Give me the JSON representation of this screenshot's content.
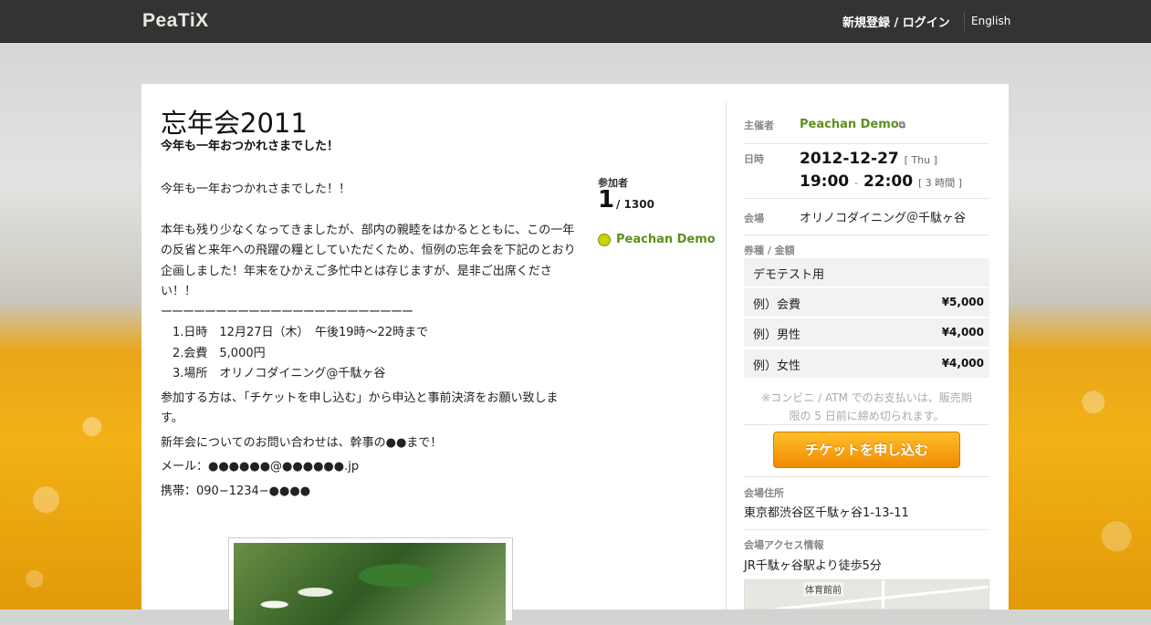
{
  "header": {
    "logo": "PeaTiX",
    "login": "新規登録 / ログイン",
    "language": "English"
  },
  "event": {
    "title": "忘年会2011",
    "subtitle": "今年も一年おつかれさまでした！",
    "description": [
      "今年も一年おつかれさまでした！！",
      "",
      "本年も残り少なくなってきましたが、部内の親睦をはかるとともに、この一年の反省と来年への飛躍の糧としていただくため、恒例の忘年会を下記のとおり企画しました！年末をひかえご多忙中とは存じますが、是非ご出席ください！！",
      "ーーーーーーーーーーーーーーーーーーーーーーー",
      "　1.日時　12月27日（木）　午後19時～22時まで",
      "　2.会費　5,000円",
      "　3.場所　オリノコダイニング@千駄ヶ谷"
    ],
    "description2": [
      "参加する方は、「チケットを申し込む」から申込と事前決済をお願い致します。",
      "新年会についてのお問い合わせは、幹事の●●まで！",
      "メール：●●●●●●@●●●●●●.jp",
      "携帯：090−1234−●●●●"
    ]
  },
  "attendees": {
    "label": "参加者",
    "count": "1",
    "total": "/ 1300",
    "list": [
      {
        "name": "Peachan Demo",
        "avatar": "avatar-icon"
      }
    ]
  },
  "sidebar": {
    "organizer_label": "主催者",
    "organizer_name": "Peachan Demo",
    "external_icon": "external-link-icon",
    "date_label": "日時",
    "date": "2012-12-27",
    "weekday": "[ Thu ]",
    "time_start": "19:00",
    "time_sep": "-",
    "time_end": "22:00",
    "duration": "[ 3 時間 ]",
    "venue_label": "会場",
    "venue": "オリノコダイニング＠千駄ヶ谷",
    "tickets_label": "券種 / 金額",
    "tickets": [
      {
        "name": "デモテスト用",
        "price": ""
      },
      {
        "name": "例）会費",
        "price": "¥5,000"
      },
      {
        "name": "例）男性",
        "price": "¥4,000"
      },
      {
        "name": "例）女性",
        "price": "¥4,000"
      }
    ],
    "notice_line1": "※コンビニ / ATM でのお支払いは、販売期",
    "notice_line2": "限の 5 日前に締め切られます。",
    "apply_button": "チケットを申し込む",
    "address_label": "会場住所",
    "address": "東京都渋谷区千駄ヶ谷1-13-11",
    "access_label": "会場アクセス情報",
    "access": "JR千駄ヶ谷駅より徒歩5分",
    "map_label": "体育館前"
  },
  "colors": {
    "accent_green": "#5e8f1c",
    "button_orange": "#f08a00",
    "topbar": "#333333"
  }
}
